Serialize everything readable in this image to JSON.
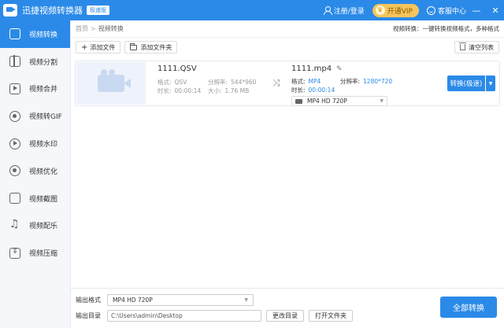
{
  "app": {
    "title": "迅捷视频转换器",
    "badge": "极速版"
  },
  "titlebar": {
    "login": "注册/登录",
    "vip": "开通VIP",
    "service": "客服中心",
    "minimize": "—",
    "close": "✕"
  },
  "sidebar": {
    "items": [
      {
        "label": "视频转换",
        "icon": "convert-icon",
        "active": true
      },
      {
        "label": "视频分割",
        "icon": "split-icon"
      },
      {
        "label": "视频合并",
        "icon": "merge-icon"
      },
      {
        "label": "视频转GIF",
        "icon": "gif-icon"
      },
      {
        "label": "视频水印",
        "icon": "watermark-icon"
      },
      {
        "label": "视频优化",
        "icon": "optimize-icon"
      },
      {
        "label": "视频截图",
        "icon": "screenshot-icon"
      },
      {
        "label": "视频配乐",
        "icon": "music-icon"
      },
      {
        "label": "视频压缩",
        "icon": "compress-icon"
      }
    ]
  },
  "breadcrumb": {
    "home": "首页",
    "sep": ">",
    "current": "视频转换",
    "description": "视频转换：一键转换视频格式，多种格式"
  },
  "toolbar": {
    "add_file": "添加文件",
    "add_folder": "添加文件夹",
    "clear_list": "清空列表"
  },
  "file": {
    "source": {
      "name": "1111.QSV",
      "format_label": "格式:",
      "format": "QSV",
      "resolution_label": "分辨率:",
      "resolution": "544*960",
      "duration_label": "时长:",
      "duration": "00:00:14",
      "size_label": "大小:",
      "size": "1.76 MB"
    },
    "output": {
      "name": "1111.mp4",
      "format_label": "格式:",
      "format": "MP4",
      "resolution_label": "分辨率:",
      "resolution": "1280*720",
      "duration_label": "时长:",
      "duration": "00:00:14",
      "preset": "MP4  HD 720P"
    },
    "convert_button": "转换(极速)"
  },
  "bottom": {
    "format_label": "输出格式",
    "format_value": "MP4  HD 720P",
    "dir_label": "输出目录",
    "dir_value": "C:\\Users\\admin\\Desktop",
    "change_dir": "更改目录",
    "open_folder": "打开文件夹",
    "convert_all": "全部转换"
  },
  "colors": {
    "accent": "#2b8ae8",
    "vip": "#f5c55b"
  }
}
